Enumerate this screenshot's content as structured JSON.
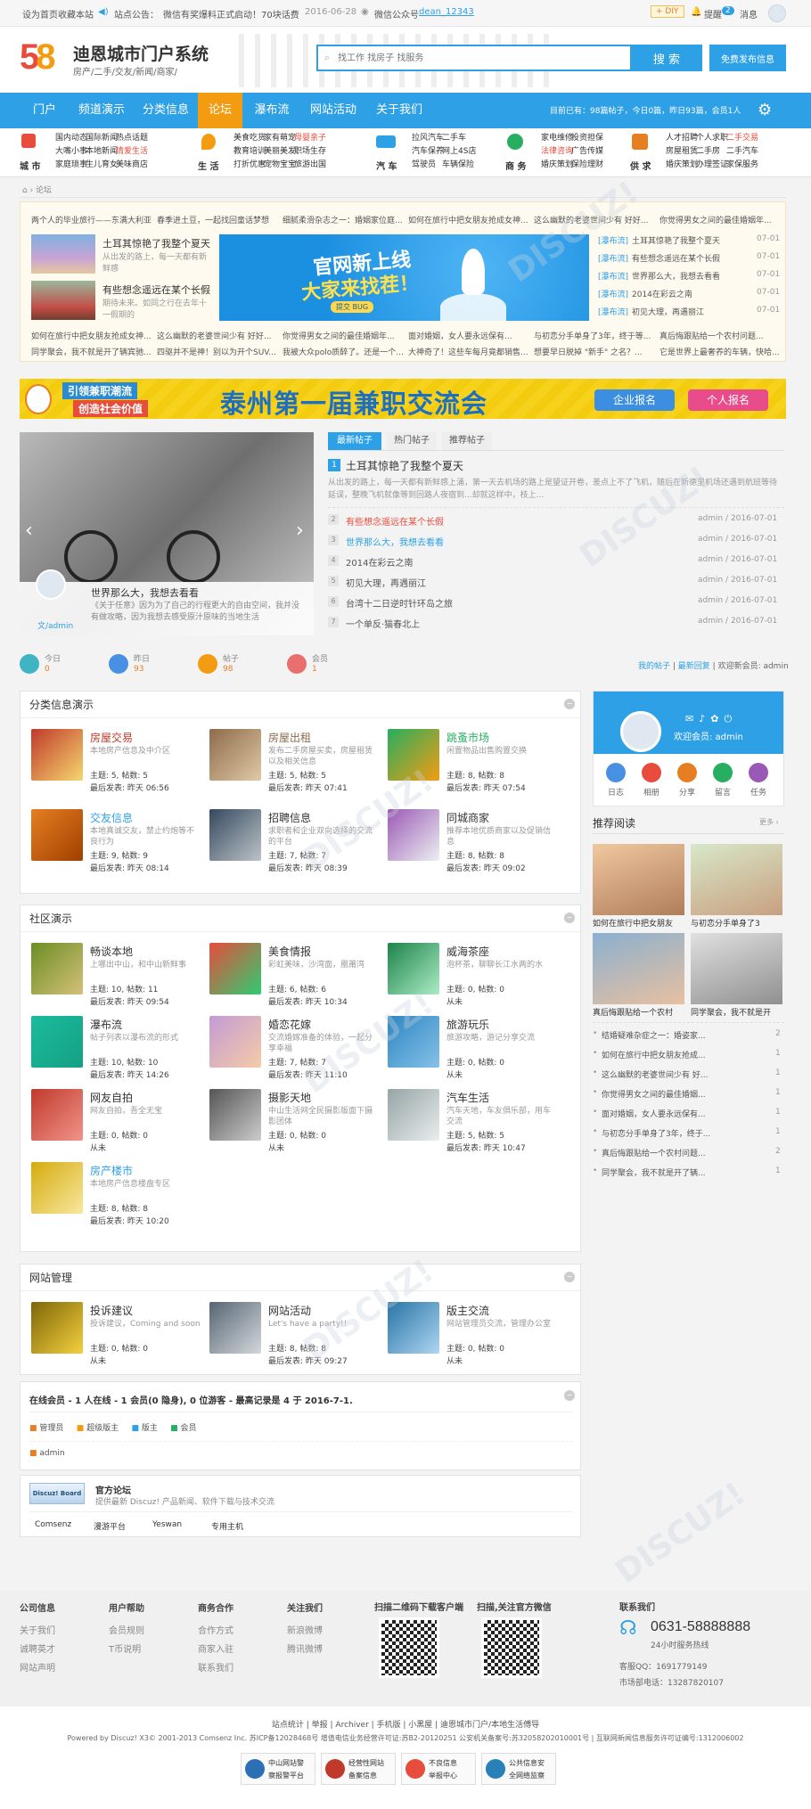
{
  "topbar": {
    "set_home": "设为首页",
    "bookmark": "收藏本站",
    "notice_label": "站点公告：",
    "notice_text": "微信有奖爆料正式启动！70块话费",
    "notice_date": "2016-06-28",
    "wechat_label": "微信公众号",
    "wechat_id": "dean_12343",
    "diy": "DIY",
    "reminder": "提醒",
    "reminder_count": "2",
    "messages": "消息"
  },
  "header": {
    "logo_number": "58",
    "logo_title": "迪恩城市门户系统",
    "logo_sub": "房产/二手/交友/新闻/商家/",
    "search_placeholder": "找工作 找房子 找服务",
    "search_button": "搜 索",
    "post_button": "免费发布信息"
  },
  "nav": {
    "items": [
      "门户",
      "频道演示",
      "分类信息",
      "论坛",
      "瀑布流",
      "网站活动",
      "关于我们"
    ],
    "active": "论坛",
    "stats": "目前已有：98篇帖子，今日0篇，昨日93篇，会员1人"
  },
  "categories": [
    {
      "name": "城 市",
      "color": "#e74c3c",
      "links": [
        "国内动态",
        "国际新闻",
        "热点话题",
        "大嘴小事",
        "本地新闻",
        "情爱生活",
        "家庭琐事",
        "生儿育女",
        "美味商店"
      ]
    },
    {
      "name": "生 活",
      "color": "#f39c12",
      "links": [
        "美食吃货",
        "家有萌宠",
        "母婴亲子",
        "教育培训",
        "美丽美发",
        "职场生存",
        "打折优惠",
        "宠物宝宝",
        "旅游出国"
      ]
    },
    {
      "name": "汽 车",
      "color": "#2ea0e6",
      "links": [
        "拉风汽车",
        "二手车",
        "汽车保养",
        "网上4S店",
        "驾驶员",
        "车辆保险"
      ]
    },
    {
      "name": "商 务",
      "color": "#27ae60",
      "links": [
        "家电维修",
        "投资担保",
        "法律咨询",
        "广告传媒",
        "婚庆策划",
        "保险理财"
      ]
    },
    {
      "name": "供 求",
      "color": "#e67e22",
      "links": [
        "人才招聘",
        "个人求职",
        "二手交易",
        "房屋租赁",
        "二手房",
        "二手汽车",
        "婚庆策划",
        "办理签证",
        "家保服务"
      ]
    }
  ],
  "breadcrumb": "论坛",
  "ticker_top": [
    "两个人的毕业旅行——东满大利亚",
    "春季进土豆，一起找回童话梦想",
    "细腻柔滑杂志之一：婚姻家位庭...",
    "如何在旅行中把女朋友抢成女神...",
    "这么幽默的老婆世间少有 好好...",
    "你觉得男女之间的最佳婚姻年..."
  ],
  "news_left": [
    {
      "title": "土耳其惊艳了我整个夏天",
      "desc": "从出发的路上，每一天都有新鲜感"
    },
    {
      "title": "有些想念遥远在某个长假",
      "desc": "期待未来。如同之行在去年十一假期的"
    }
  ],
  "banner": {
    "title1": "官网新上线",
    "title2": "大家来找茬！",
    "sub": "提交 BUG"
  },
  "news_right": [
    {
      "tag": "[瀑布流]",
      "title": "土耳其惊艳了我整个夏天",
      "date": "07-01"
    },
    {
      "tag": "[瀑布流]",
      "title": "有些想念遥远在某个长假",
      "date": "07-01"
    },
    {
      "tag": "[瀑布流]",
      "title": "世界那么大，我想去看看",
      "date": "07-01"
    },
    {
      "tag": "[瀑布流]",
      "title": "2014在彩云之南",
      "date": "07-01"
    },
    {
      "tag": "[瀑布流]",
      "title": "初见大理，再遇丽江",
      "date": "07-01"
    }
  ],
  "ticker_bottom": [
    "如何在旅行中把女朋友抢成女神...",
    "这么幽默的老婆世间少有 好好...",
    "你觉得男女之间的最佳婚姻年...",
    "面对婚姻，女人要永远保有...",
    "与初恋分手单身了3年，终于等...",
    "真后悔跟贴给一个农村问题..."
  ],
  "ticker_bottom2": [
    "同学聚会，我不就是开了辆宾驰...",
    "四驱并不是神！别以为开个SUV...",
    "我被大众polo质醉了。还是一个...",
    "大神奇了！这些车每月竟都销售...",
    "想要早日脱掉 \"新手\" 之名？...",
    "它是世界上最奢养的车辆，快哈..."
  ],
  "ad_banner": {
    "left1": "引领兼职潮流",
    "left2": "创造社会价值",
    "main": "泰州第一届兼职交流会",
    "btn1": "企业报名",
    "btn2": "个人报名"
  },
  "slider": {
    "title": "世界那么大，我想去看看",
    "desc": "《关于任意》因为为了自己的行程更大的自由空间，我并没有做攻略，因为我想去感受原汁原味的当地生活",
    "author": "文/admin"
  },
  "tabs": [
    "最新帖子",
    "热门帖子",
    "推荐帖子"
  ],
  "featured": {
    "num": "1",
    "title": "土耳其惊艳了我整个夏天",
    "desc": "从出发的路上，每一天都有新鲜感上涌，第一天去机场的路上是望证开卷，差点上不了飞机，随后在新德里机场还遇到航班等待延误，整晚飞机就像等到回路人夜宿到...却就这样中，枝上..."
  },
  "posts": [
    {
      "num": "2",
      "title": "有些想念遥远在某个长假",
      "author": "admin / 2016-07-01",
      "color": "#e74c3c"
    },
    {
      "num": "3",
      "title": "世界那么大，我想去看看",
      "author": "admin / 2016-07-01",
      "color": "#2ea0e6"
    },
    {
      "num": "4",
      "title": "2014在彩云之南",
      "author": "admin / 2016-07-01",
      "color": "#555"
    },
    {
      "num": "5",
      "title": "初见大理，再遇丽江",
      "author": "admin / 2016-07-01",
      "color": "#555"
    },
    {
      "num": "6",
      "title": "台湾十二日逆时针环岛之旅",
      "author": "admin / 2016-07-01",
      "color": "#555"
    },
    {
      "num": "7",
      "title": "一个单反·猫春北上",
      "author": "admin / 2016-07-01",
      "color": "#555"
    }
  ],
  "stats_row": [
    {
      "label": "今日",
      "value": "0",
      "color": "#3fb5c4"
    },
    {
      "label": "昨日",
      "value": "93",
      "color": "#4a90e2"
    },
    {
      "label": "帖子",
      "value": "98",
      "color": "#f39c12"
    },
    {
      "label": "会员",
      "value": "1",
      "color": "#e96f6f"
    }
  ],
  "stats_links": {
    "my_posts": "我的帖子",
    "latest_reply": "最新回复",
    "welcome": "欢迎新会员: admin"
  },
  "sections": [
    {
      "title": "分类信息演示",
      "forums": [
        {
          "name": "房屋交易",
          "desc": "本地房产信息及中介区",
          "stat1": "主题: 5, 帖数: 5",
          "stat2": "最后发表: 昨天 06:56",
          "color": "#c0392b"
        },
        {
          "name": "房屋出租",
          "desc": "发布二手房屋买卖，房屋租赁以及相关信息",
          "stat1": "主题: 5, 帖数: 5",
          "stat2": "最后发表: 昨天 07:41",
          "color": "#8e6b4a"
        },
        {
          "name": "跳蚤市场",
          "desc": "闲置物品出售购置交换",
          "stat1": "主题: 8, 帖数: 8",
          "stat2": "最后发表: 昨天 07:54",
          "color": "#27ae60"
        },
        {
          "name": "交友信息",
          "desc": "本地真诚交友，禁止约炮等不良行为",
          "stat1": "主题: 9, 帖数: 9",
          "stat2": "最后发表: 昨天 08:14",
          "color": "#2ea0e6"
        },
        {
          "name": "招聘信息",
          "desc": "求职者和企业双向选择的交流的平台",
          "stat1": "主题: 7, 帖数: 7",
          "stat2": "最后发表: 昨天 08:39",
          "color": "#333"
        },
        {
          "name": "同城商家",
          "desc": "推荐本地优质商家以及促销信息",
          "stat1": "主题: 8, 帖数: 8",
          "stat2": "最后发表: 昨天 09:02",
          "color": "#333"
        }
      ]
    },
    {
      "title": "社区演示",
      "forums": [
        {
          "name": "畅谈本地",
          "desc": "上哪出中山，和中山新鲜事",
          "stat1": "主题: 10, 帖数: 11",
          "stat2": "最后发表: 昨天 09:54",
          "color": "#333"
        },
        {
          "name": "美食情报",
          "desc": "彩虹美味，沙湾面，凰莆湾",
          "stat1": "主题: 6, 帖数: 6",
          "stat2": "最后发表: 昨天 10:34",
          "color": "#333"
        },
        {
          "name": "威海茶座",
          "desc": "泡杯茶，聊聊长江水两的水",
          "stat1": "主题: 0, 帖数: 0",
          "stat2": "从未",
          "color": "#333"
        },
        {
          "name": "瀑布流",
          "desc": "帖子列表以瀑布流的形式",
          "stat1": "主题: 10, 帖数: 10",
          "stat2": "最后发表: 昨天 14:26",
          "color": "#333"
        },
        {
          "name": "婚恋花嫁",
          "desc": "交流婚嫁准备的体验，一起分享幸福",
          "stat1": "主题: 7, 帖数: 7",
          "stat2": "最后发表: 昨天 11:10",
          "color": "#333"
        },
        {
          "name": "旅游玩乐",
          "desc": "旅游攻略，游记分享交流",
          "stat1": "主题: 0, 帖数: 0",
          "stat2": "从未",
          "color": "#333"
        },
        {
          "name": "网友自拍",
          "desc": "网友自拍，吾全无宝",
          "stat1": "主题: 0, 帖数: 0",
          "stat2": "从未",
          "color": "#333"
        },
        {
          "name": "摄影天地",
          "desc": "中山生活网全民摄影版面下摄影团体",
          "stat1": "主题: 0, 帖数: 0",
          "stat2": "从未",
          "color": "#333"
        },
        {
          "name": "汽车生活",
          "desc": "汽车天地，车友俱乐部，用车交流",
          "stat1": "主题: 5, 帖数: 5",
          "stat2": "最后发表: 昨天 10:47",
          "color": "#333"
        },
        {
          "name": "房产楼市",
          "desc": "本地房产信息楼盘专区",
          "stat1": "主题: 8, 帖数: 8",
          "stat2": "最后发表: 昨天 10:20",
          "color": "#2ea0e6"
        }
      ]
    },
    {
      "title": "网站管理",
      "forums": [
        {
          "name": "投诉建议",
          "desc": "投诉建议，Coming and soon",
          "stat1": "主题: 0, 帖数: 0",
          "stat2": "从未",
          "color": "#333"
        },
        {
          "name": "网站活动",
          "desc": "Let's have a party!!",
          "stat1": "主题: 8, 帖数: 8",
          "stat2": "最后发表: 昨天 09:27",
          "color": "#333"
        },
        {
          "name": "版主交流",
          "desc": "网站管理员交流，管理办公室",
          "stat1": "主题: 0, 帖数: 0",
          "stat2": "从未",
          "color": "#333"
        }
      ]
    }
  ],
  "online": {
    "title": "在线会员 - 1 人在线 - 1 会员(0 隐身), 0 位游客 - 最高记录是 4 于 2016-7-1.",
    "legend": [
      "管理员",
      "超级版主",
      "版主",
      "会员"
    ],
    "user": "admin"
  },
  "links": {
    "official_title": "官方论坛",
    "official_desc": "提供最新 Discuz! 产品新闻、软件下载与技术交流",
    "logo_text": "Discuz! Board",
    "items": [
      "Comsenz",
      "漫游平台",
      "Yeswan",
      "专用主机"
    ]
  },
  "user_card": {
    "welcome": "欢迎会员: admin",
    "actions": [
      {
        "label": "日志",
        "color": "#4a90e2"
      },
      {
        "label": "相册",
        "color": "#e74c3c"
      },
      {
        "label": "分享",
        "color": "#e67e22"
      },
      {
        "label": "留言",
        "color": "#27ae60"
      },
      {
        "label": "任务",
        "color": "#9b59b6"
      }
    ]
  },
  "recommend": {
    "title": "推荐阅读",
    "more": "更多 ›",
    "images": [
      "如何在旅行中把女朋友",
      "与初恋分手单身了3",
      "真后悔跟贴给一个农村",
      "同学聚会，我不就是开"
    ],
    "list": [
      {
        "t": "结婚疑难杂症之一：婚姿家...",
        "n": "2"
      },
      {
        "t": "如何在旅行中把女朋友抢成...",
        "n": "1"
      },
      {
        "t": "这么幽默的老婆世间少有 好...",
        "n": "1"
      },
      {
        "t": "你觉得男女之间的最佳婚姻...",
        "n": "1"
      },
      {
        "t": "面对婚姻，女人要永远保有...",
        "n": "1"
      },
      {
        "t": "与初恋分手单身了3年，终于...",
        "n": "1"
      },
      {
        "t": "真后悔跟贴给一个农村问题...",
        "n": "2"
      },
      {
        "t": "同学聚会，我不就是开了辆...",
        "n": "1"
      }
    ]
  },
  "footer": {
    "cols": [
      {
        "title": "公司信息",
        "items": [
          "关于我们",
          "诚聘英才",
          "网站声明"
        ]
      },
      {
        "title": "用户帮助",
        "items": [
          "会员规则",
          "T币说明"
        ]
      },
      {
        "title": "商务合作",
        "items": [
          "合作方式",
          "商家入驻",
          "联系我们"
        ]
      },
      {
        "title": "关注我们",
        "items": [
          "新浪微博",
          "腾讯微博"
        ]
      }
    ],
    "qr1": "扫描二维码下载客户端",
    "qr2": "扫描,关注官方微信",
    "contact_title": "联系我们",
    "phone": "0631-58888888",
    "hours": "24小时服务热线",
    "qq": "客服QQ：1691779149",
    "market": "市场部电话：13287820107",
    "bottom_links": "站点统计 | 举报 | Archiver | 手机版 | 小黑屋 | 迪恩城市门户/本地生活傅导",
    "powered": "Powered by Discuz! X3© 2001-2013 Comsenz Inc. 苏ICP备12028468号 增值电信业务经营许可证:苏B2-20120251 公安机关备案号:苏32058202010001号 | 互联网新闻信息服务许可证编号:1312006002",
    "badges": [
      {
        "l1": "中山网站警",
        "l2": "察报警平台",
        "c": "#2c6fb5"
      },
      {
        "l1": "经营性网站",
        "l2": "备案信息",
        "c": "#c0392b"
      },
      {
        "l1": "不良信息",
        "l2": "举报中心",
        "c": "#e74c3c"
      },
      {
        "l1": "公共信息安",
        "l2": "全网络监察",
        "c": "#2980b9"
      }
    ]
  }
}
